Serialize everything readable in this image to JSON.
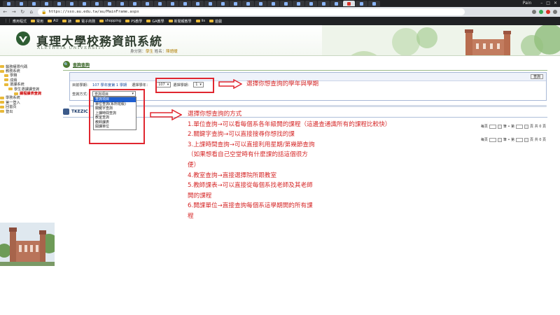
{
  "browser": {
    "url": "https://sso.au.edu.tw/au/MainFrame.aspx",
    "user": "Pain",
    "bookmarks": [
      "應用程式",
      "常用",
      "AU",
      "錶",
      "電子商務",
      "shopping",
      "PS教學",
      "GA教學",
      "新聞報教學",
      "iis",
      "遊戲"
    ]
  },
  "site": {
    "title": "真理大學校務資訊系統",
    "subtitle": "ALETHEIA UNIVERSITY",
    "identity_prefix": "身分別：",
    "identity_role": "學生",
    "identity_name_label": "姓名：",
    "identity_name": "陳語暖"
  },
  "sidebar": {
    "items": [
      {
        "label": "醫務權限代碼",
        "indent": 0
      },
      {
        "label": "教務系統",
        "indent": 0
      },
      {
        "label": "學籍",
        "indent": 1
      },
      {
        "label": "成績",
        "indent": 1
      },
      {
        "label": "選課系統",
        "indent": 1
      },
      {
        "label": "學生選課課查詢",
        "indent": 2
      },
      {
        "label": "課程課表查詢",
        "indent": 3,
        "selected": true
      },
      {
        "label": "學務系統",
        "indent": 0
      },
      {
        "label": "第一登入",
        "indent": 0
      },
      {
        "label": "回首頁",
        "indent": 0
      },
      {
        "label": "登出",
        "indent": 0
      }
    ]
  },
  "main": {
    "section_title": "查詢查詢",
    "query_button": "查詢",
    "current_term_label": "目前學期：",
    "current_term_value": "107 學年度第 1 學期",
    "year_label": "選擇學年：",
    "year_value": "107",
    "semester_label": "選擇學期：",
    "semester_value": "1",
    "mode_label": "查詢方式：",
    "mode_value": "查詢項目",
    "dropdown_options": [
      "查詢項目",
      "單位查詢(系所班級)",
      "關鍵字查詢",
      "上課時間查詢",
      "教室查詢",
      "教師課表",
      "開課單位"
    ],
    "dropdown_highlight_index": 0,
    "result_tab": "TKEZIC",
    "pager": {
      "per_page_label": "每頁",
      "per_page_value": "20",
      "page_label": "筆 • 第",
      "page_value": "1",
      "total": "頁 共 0 頁",
      "rows_suffix": "共 0 筆"
    }
  },
  "annotations": {
    "top_note": "選擇你想查詢的學年與學期",
    "lines": [
      "選擇你想查詢的方式",
      "1.單位查詢→可以看每個系各年級開的課程（這邊查通識所有的課程比較快）",
      "2.關鍵字查詢→可以直接搜尋你想找的課",
      "3.上課時間查詢→可以直接利用星期/第幾節查詢",
      "（如果想看自己空堂時有什麼課的話這個很方",
      "便）",
      "4.教室查詢→直接選擇院所跟教室",
      "5.教師課表→可以直接從每個系找老師及其老師",
      "開的課程",
      "6.開課單位→直接查詢每個系這學期開的所有課",
      "程"
    ]
  },
  "colors": {
    "annotation": "#d62a2a",
    "highlight": "#1e5fd1",
    "brand_green": "#4a7a2d"
  }
}
